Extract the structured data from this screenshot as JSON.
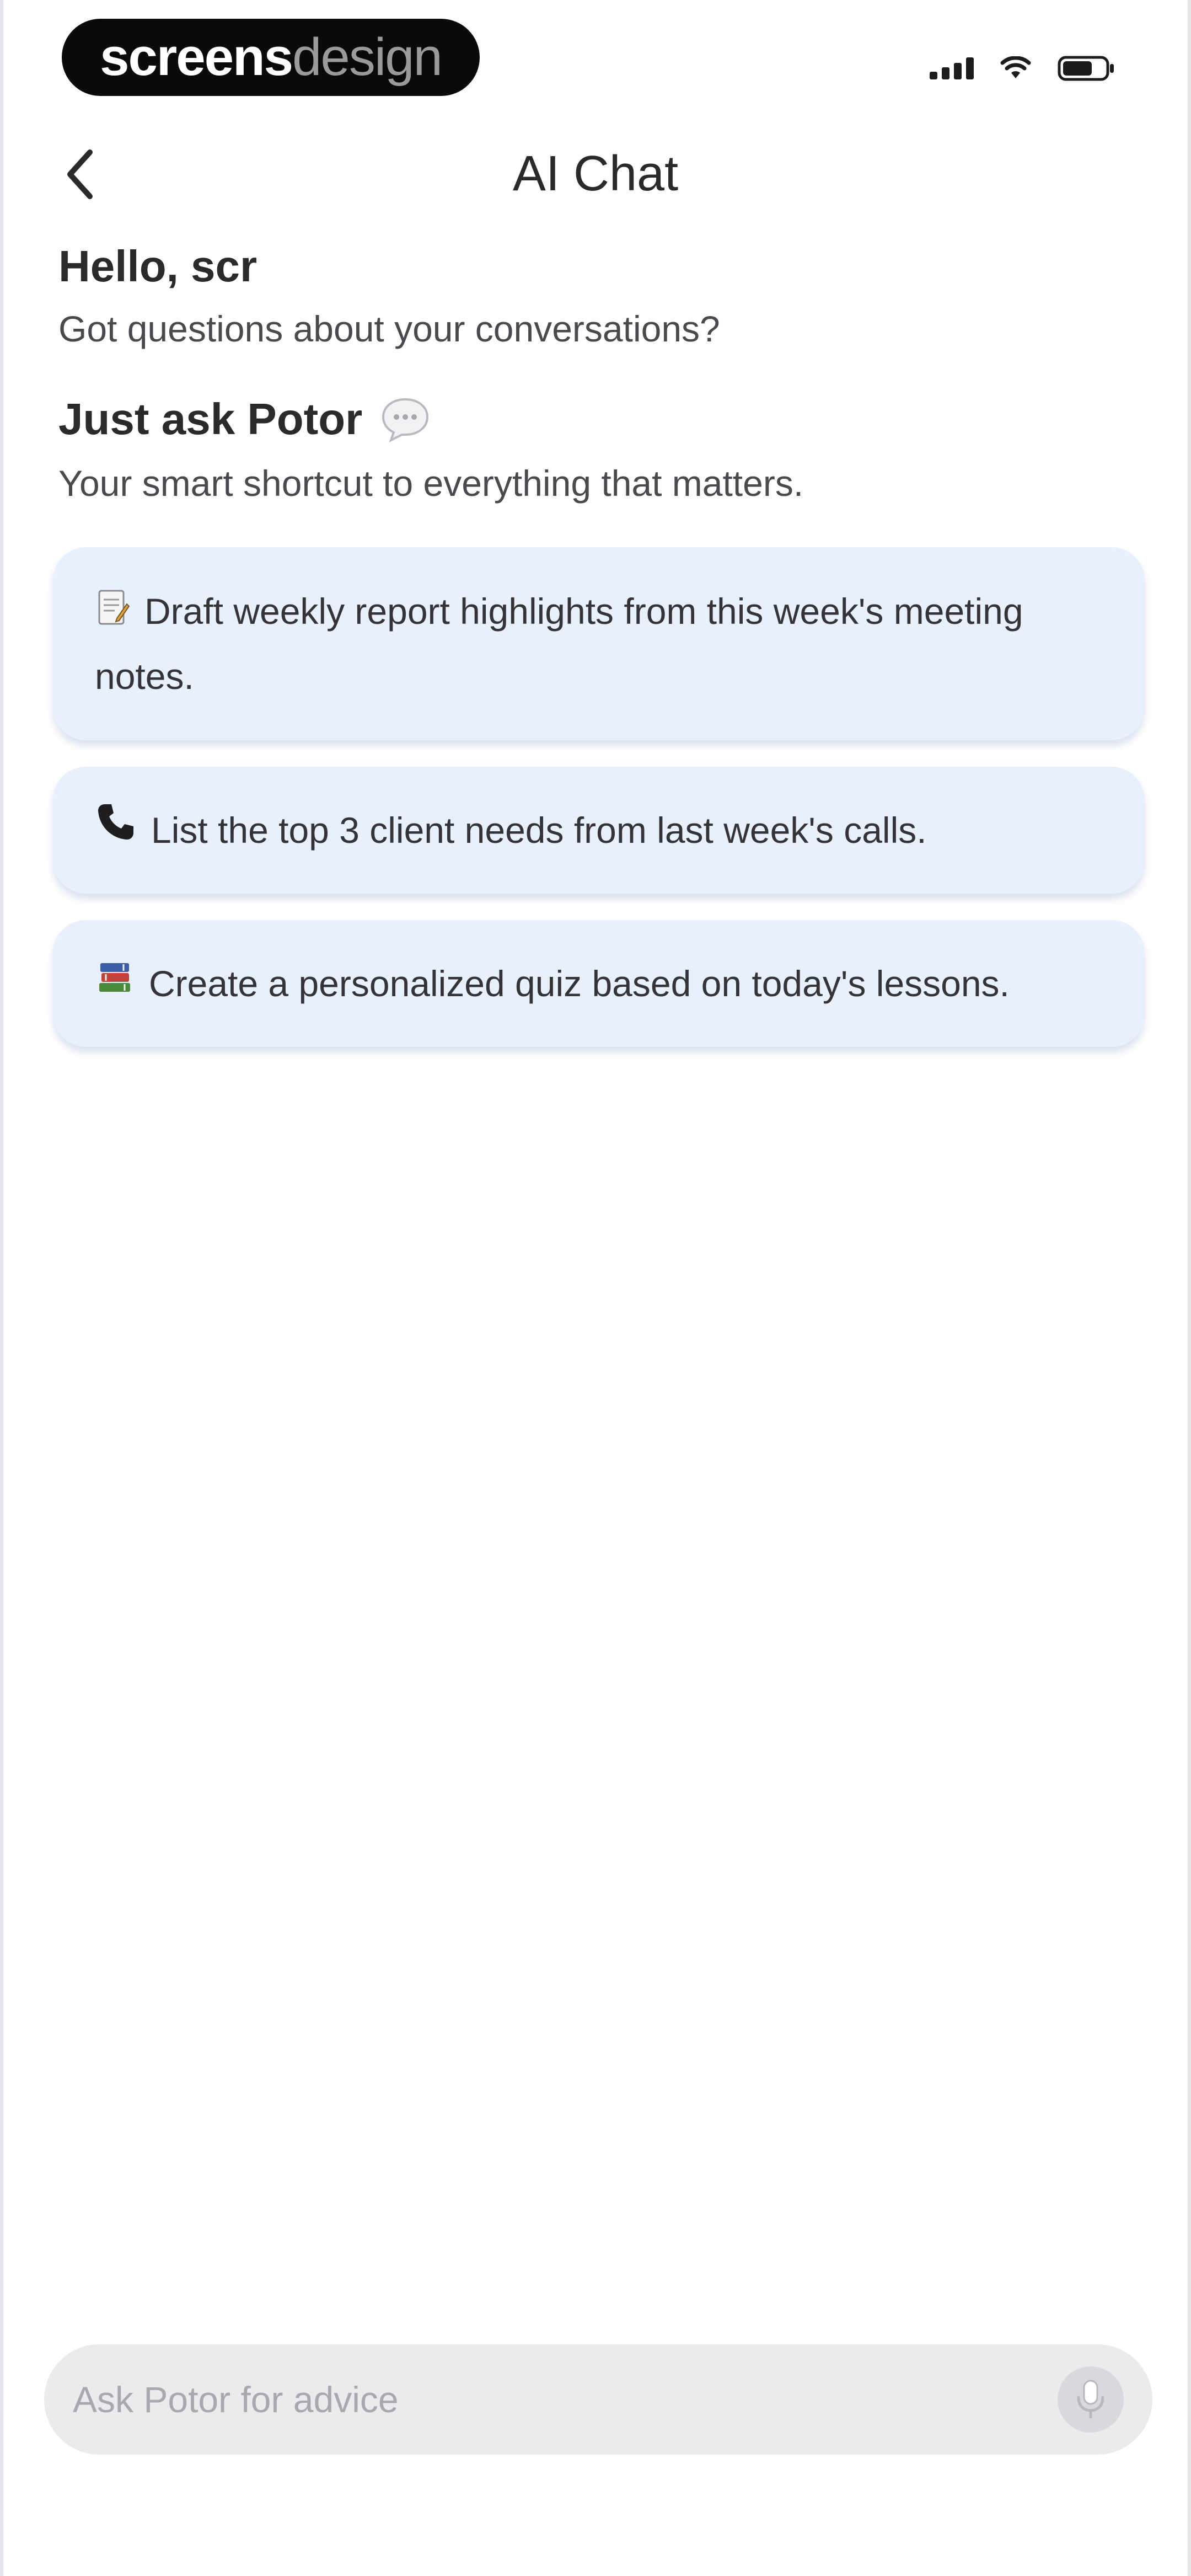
{
  "status_bar": {
    "brand_strong": "screens",
    "brand_light": "design"
  },
  "header": {
    "title": "AI Chat",
    "back_icon": "chevron-left-icon"
  },
  "intro": {
    "greeting": "Hello, scr",
    "subgreeting": "Got questions about your conversations?",
    "ask_heading": "Just ask Potor",
    "ask_icon": "speech-bubble-icon",
    "tagline": "Your smart shortcut to everything that matters."
  },
  "suggestions": [
    {
      "icon": "memo-icon",
      "text": "Draft weekly report highlights from this week's meeting notes."
    },
    {
      "icon": "telephone-icon",
      "text": "List the top 3 client needs from last week's calls."
    },
    {
      "icon": "books-icon",
      "text": "Create a personalized quiz based on today's lessons."
    }
  ],
  "composer": {
    "placeholder": "Ask Potor for advice",
    "value": "",
    "mic_icon": "microphone-icon"
  }
}
